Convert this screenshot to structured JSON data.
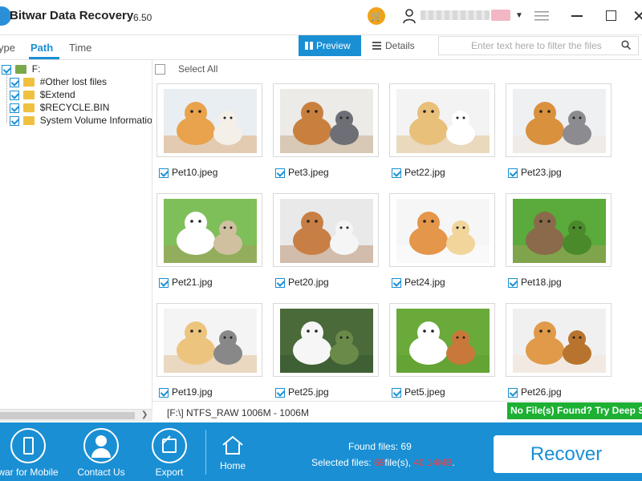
{
  "app": {
    "title": "Bitwar Data Recovery",
    "version": "6.50"
  },
  "tabs": [
    {
      "label": "ype"
    },
    {
      "label": "Path"
    },
    {
      "label": "Time"
    }
  ],
  "view": {
    "preview_label": "Preview",
    "details_label": "Details",
    "filter_placeholder": "Enter text here to filter the files"
  },
  "tree": {
    "root": "F:",
    "items": [
      {
        "label": "#Other lost files"
      },
      {
        "label": "$Extend"
      },
      {
        "label": "$RECYCLE.BIN"
      },
      {
        "label": "System Volume Information"
      }
    ]
  },
  "grid": {
    "select_all": "Select All",
    "files": [
      {
        "name": "Pet10.jpeg"
      },
      {
        "name": "Pet3.jpeg"
      },
      {
        "name": "Pet22.jpg"
      },
      {
        "name": "Pet23.jpg"
      },
      {
        "name": "Pet21.jpg"
      },
      {
        "name": "Pet20.jpg"
      },
      {
        "name": "Pet24.jpg"
      },
      {
        "name": "Pet18.jpg"
      },
      {
        "name": "Pet19.jpg"
      },
      {
        "name": "Pet25.jpg"
      },
      {
        "name": "Pet5.jpeg"
      },
      {
        "name": "Pet26.jpg"
      }
    ]
  },
  "status": {
    "path": "[F:\\] NTFS_RAW 1006M - 1006M",
    "notice": "No File(s) Found? Try Deep S"
  },
  "bottom": {
    "mobile_label": "war for Mobile",
    "contact_label": "Contact Us",
    "export_label": "Export",
    "home_label": "Home",
    "found_label": "Found files:",
    "found_count": "69",
    "selected_label": "Selected files:",
    "selected_count": "69",
    "selected_unit": "file(s),",
    "selected_size": "40.14MB",
    "selected_end": ".",
    "recover_label": "Recover"
  },
  "colors": {
    "accent": "#1a8fd4",
    "notice": "#1db033",
    "highlight": "#ff3b3b",
    "cart": "#f0a31a"
  }
}
